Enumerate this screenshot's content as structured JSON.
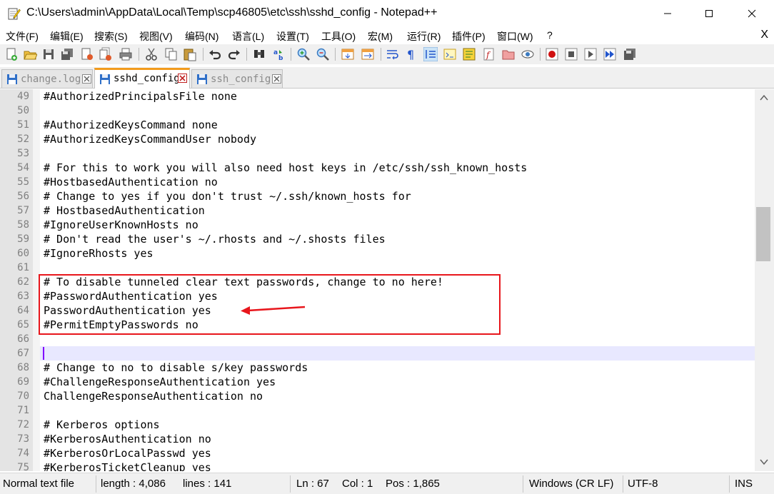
{
  "window": {
    "title": "C:\\Users\\admin\\AppData\\Local\\Temp\\scp46805\\etc\\ssh\\sshd_config - Notepad++",
    "menu_close": "X"
  },
  "menu": [
    {
      "label": "文件(F)"
    },
    {
      "label": "编辑(E)"
    },
    {
      "label": "搜索(S)"
    },
    {
      "label": "视图(V)"
    },
    {
      "label": "编码(N)"
    },
    {
      "label": "语言(L)"
    },
    {
      "label": "设置(T)"
    },
    {
      "label": "工具(O)"
    },
    {
      "label": "宏(M)"
    },
    {
      "label": "运行(R)"
    },
    {
      "label": "插件(P)"
    },
    {
      "label": "窗口(W)"
    },
    {
      "label": "?"
    }
  ],
  "tabs": [
    {
      "label": "change.log",
      "active": false
    },
    {
      "label": "sshd_config",
      "active": true
    },
    {
      "label": "ssh_config",
      "active": false
    }
  ],
  "editor": {
    "lines": [
      {
        "num": "49",
        "text": "#AuthorizedPrincipalsFile none"
      },
      {
        "num": "50",
        "text": ""
      },
      {
        "num": "51",
        "text": "#AuthorizedKeysCommand none"
      },
      {
        "num": "52",
        "text": "#AuthorizedKeysCommandUser nobody"
      },
      {
        "num": "53",
        "text": ""
      },
      {
        "num": "54",
        "text": "# For this to work you will also need host keys in /etc/ssh/ssh_known_hosts"
      },
      {
        "num": "55",
        "text": "#HostbasedAuthentication no"
      },
      {
        "num": "56",
        "text": "# Change to yes if you don't trust ~/.ssh/known_hosts for"
      },
      {
        "num": "57",
        "text": "# HostbasedAuthentication"
      },
      {
        "num": "58",
        "text": "#IgnoreUserKnownHosts no"
      },
      {
        "num": "59",
        "text": "# Don't read the user's ~/.rhosts and ~/.shosts files"
      },
      {
        "num": "60",
        "text": "#IgnoreRhosts yes"
      },
      {
        "num": "61",
        "text": ""
      },
      {
        "num": "62",
        "text": "# To disable tunneled clear text passwords, change to no here!"
      },
      {
        "num": "63",
        "text": "#PasswordAuthentication yes"
      },
      {
        "num": "64",
        "text": "PasswordAuthentication yes"
      },
      {
        "num": "65",
        "text": "#PermitEmptyPasswords no"
      },
      {
        "num": "66",
        "text": ""
      },
      {
        "num": "67",
        "text": ""
      },
      {
        "num": "68",
        "text": "# Change to no to disable s/key passwords"
      },
      {
        "num": "69",
        "text": "#ChallengeResponseAuthentication yes"
      },
      {
        "num": "70",
        "text": "ChallengeResponseAuthentication no"
      },
      {
        "num": "71",
        "text": ""
      },
      {
        "num": "72",
        "text": "# Kerberos options"
      },
      {
        "num": "73",
        "text": "#KerberosAuthentication no"
      },
      {
        "num": "74",
        "text": "#KerberosOrLocalPasswd yes"
      },
      {
        "num": "75",
        "text": "#KerberosTicketCleanup yes"
      }
    ]
  },
  "status": {
    "file_type": "Normal text file",
    "length": "length : 4,086",
    "lines": "lines : 141",
    "ln": "Ln : 67",
    "col": "Col : 1",
    "pos": "Pos : 1,865",
    "eol": "Windows (CR LF)",
    "encoding": "UTF-8",
    "mode": "INS"
  },
  "colors": {
    "annotation": "#e8161c",
    "active_tab_accent": "#f29b1d",
    "caret_line": "#e8e8ff",
    "caret": "#8000ff"
  }
}
